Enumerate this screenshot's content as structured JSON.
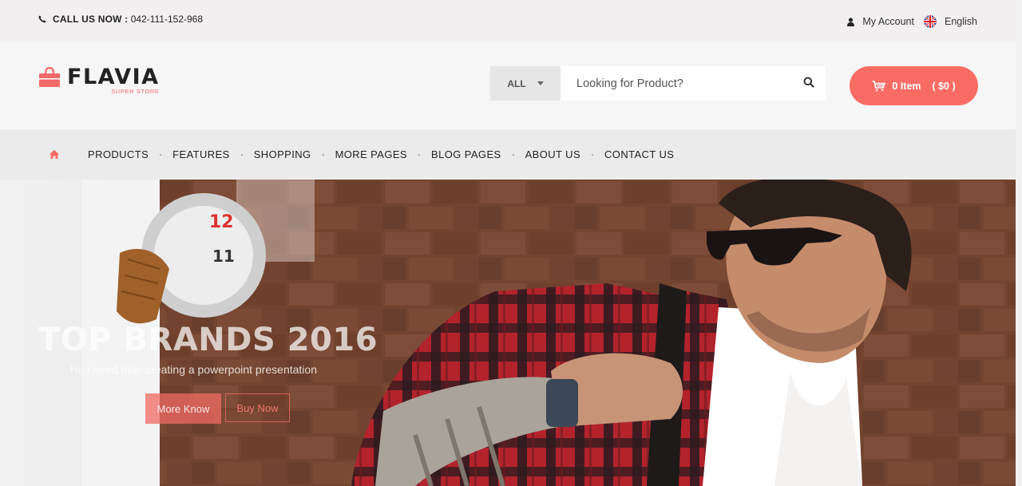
{
  "topbar": {
    "call_label": "CALL US NOW :",
    "phone": "042-111-152-968",
    "account": "My Account",
    "language": "English"
  },
  "logo": {
    "name": "FLAVIA",
    "tagline": "SUPER STORE"
  },
  "search": {
    "category": "ALL",
    "placeholder": "Looking for Product?"
  },
  "cart": {
    "items": "0 Item",
    "total": "( $0 )"
  },
  "nav": {
    "items": [
      "PRODUCTS",
      "FEATURES",
      "SHOPPING",
      "MORE PAGES",
      "BLOG PAGES",
      "ABOUT US",
      "CONTACT US"
    ]
  },
  "hero": {
    "title": "TOP BRANDS 2016",
    "subtitle": "Hi, I need help creating a powerpoint presentation",
    "more_label": "More Know",
    "buy_label": "Buy Now"
  },
  "colors": {
    "accent": "#f96c64",
    "nav_bg": "#ebebeb",
    "topbar_bg": "#f2eff0"
  },
  "icons": [
    "phone-icon",
    "user-icon",
    "uk-flag-icon",
    "shopping-bag-logo-icon",
    "caret-down-icon",
    "search-icon",
    "cart-icon",
    "home-icon"
  ]
}
